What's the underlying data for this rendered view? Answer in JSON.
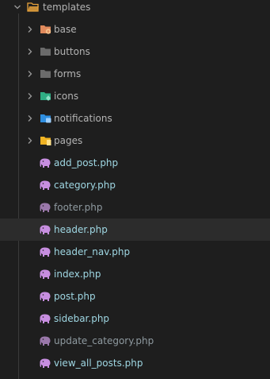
{
  "tree": {
    "root": {
      "label": "templates",
      "icon": "folder-open-icon",
      "color": "#e6a23c"
    },
    "folders": [
      {
        "label": "base",
        "icon": "folder-base-icon",
        "color": "#e08a5c",
        "badge": "#f4c08a"
      },
      {
        "label": "buttons",
        "icon": "folder-icon",
        "color": "#6b6b6b"
      },
      {
        "label": "forms",
        "icon": "folder-icon",
        "color": "#6b6b6b"
      },
      {
        "label": "icons",
        "icon": "folder-icons-icon",
        "color": "#2fae84",
        "badge": "#8fe0c6"
      },
      {
        "label": "notifications",
        "icon": "folder-notifications-icon",
        "color": "#2f8fe0",
        "badge": "#9fd0ff"
      },
      {
        "label": "pages",
        "icon": "folder-pages-icon",
        "color": "#f0b323",
        "badge": "#ffe08a"
      }
    ],
    "files": [
      {
        "label": "add_post.php",
        "icon": "php-elephant-icon",
        "dim": false
      },
      {
        "label": "category.php",
        "icon": "php-elephant-icon",
        "dim": false
      },
      {
        "label": "footer.php",
        "icon": "php-elephant-icon",
        "dim": true
      },
      {
        "label": "header.php",
        "icon": "php-elephant-icon",
        "dim": false,
        "selected": true
      },
      {
        "label": "header_nav.php",
        "icon": "php-elephant-icon",
        "dim": false
      },
      {
        "label": "index.php",
        "icon": "php-elephant-icon",
        "dim": false
      },
      {
        "label": "post.php",
        "icon": "php-elephant-icon",
        "dim": false
      },
      {
        "label": "sidebar.php",
        "icon": "php-elephant-icon",
        "dim": false
      },
      {
        "label": "update_category.php",
        "icon": "php-elephant-icon",
        "dim": true
      },
      {
        "label": "view_all_posts.php",
        "icon": "php-elephant-icon",
        "dim": false
      }
    ],
    "colors": {
      "elephant": "#c78ee0",
      "elephant_dim": "#9a78aa",
      "chevron": "#9a9a9a"
    }
  }
}
